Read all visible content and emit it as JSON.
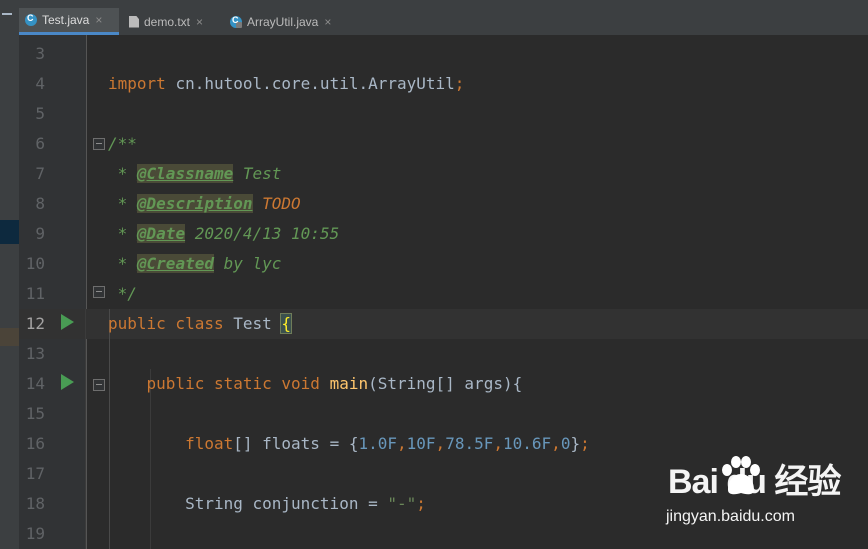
{
  "tabs": [
    {
      "label": "Test.java",
      "icon": "class-icon",
      "active": true
    },
    {
      "label": "demo.txt",
      "icon": "text-file-icon",
      "active": false
    },
    {
      "label": "ArrayUtil.java",
      "icon": "class-icon",
      "active": false
    }
  ],
  "tab_close_glyph": "×",
  "lines": [
    {
      "n": "3"
    },
    {
      "n": "4",
      "tokens": [
        [
          "kw",
          "import "
        ],
        [
          "plain",
          "cn.hutool.core.util.ArrayUtil"
        ],
        [
          "kw",
          ";"
        ]
      ]
    },
    {
      "n": "5"
    },
    {
      "n": "6",
      "tokens": [
        [
          "doc",
          "/**"
        ]
      ]
    },
    {
      "n": "7",
      "tokens": [
        [
          "doc",
          " * "
        ],
        [
          "doctag",
          "@Classname"
        ],
        [
          "doc",
          " Test"
        ]
      ]
    },
    {
      "n": "8",
      "tokens": [
        [
          "doc",
          " * "
        ],
        [
          "doctag",
          "@Description"
        ],
        [
          "doc",
          " "
        ],
        [
          "kwi",
          "TODO"
        ]
      ]
    },
    {
      "n": "9",
      "tokens": [
        [
          "doc",
          " * "
        ],
        [
          "doctag",
          "@Date"
        ],
        [
          "doc",
          " 2020/4/13 10:55"
        ]
      ]
    },
    {
      "n": "10",
      "tokens": [
        [
          "doc",
          " * "
        ],
        [
          "doctag",
          "@Created"
        ],
        [
          "doc",
          " by lyc"
        ]
      ]
    },
    {
      "n": "11",
      "tokens": [
        [
          "doc",
          " */"
        ]
      ]
    },
    {
      "n": "12",
      "tokens": [
        [
          "kw",
          "public class "
        ],
        [
          "plain",
          "Test "
        ],
        [
          "brace",
          "{"
        ]
      ]
    },
    {
      "n": "13"
    },
    {
      "n": "14",
      "tokens": [
        [
          "plain",
          "    "
        ],
        [
          "kw",
          "public static void "
        ],
        [
          "fn",
          "main"
        ],
        [
          "plain",
          "(String[] args){"
        ]
      ]
    },
    {
      "n": "15"
    },
    {
      "n": "16",
      "tokens": [
        [
          "plain",
          "        "
        ],
        [
          "kw",
          "float"
        ],
        [
          "plain",
          "[] floats = {"
        ],
        [
          "num",
          "1.0F"
        ],
        [
          "kw",
          ","
        ],
        [
          "num",
          "10F"
        ],
        [
          "kw",
          ","
        ],
        [
          "num",
          "78.5F"
        ],
        [
          "kw",
          ","
        ],
        [
          "num",
          "10.6F"
        ],
        [
          "kw",
          ","
        ],
        [
          "num",
          "0"
        ],
        [
          "plain",
          "}"
        ],
        [
          "kw",
          ";"
        ]
      ]
    },
    {
      "n": "17"
    },
    {
      "n": "18",
      "tokens": [
        [
          "plain",
          "        String conjunction = "
        ],
        [
          "str",
          "\"-\""
        ],
        [
          "kw",
          ";"
        ]
      ]
    },
    {
      "n": "19"
    }
  ],
  "watermark": {
    "logo": "Bai du 经验",
    "url": "jingyan.baidu.com"
  },
  "colors": {
    "keyword": "#cc7832",
    "plain": "#a9b7c6",
    "number": "#6897bb",
    "string": "#6a8759",
    "doc": "#629755",
    "method": "#ffc66d"
  }
}
